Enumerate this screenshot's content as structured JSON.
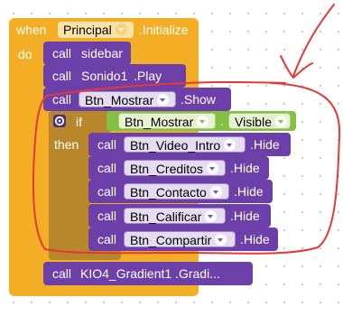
{
  "event_block": {
    "when_label": "when",
    "component": "Principal",
    "event": ".Initialize",
    "do_label": "do"
  },
  "statements": [
    {
      "call": "call",
      "name": "sidebar"
    },
    {
      "call": "call",
      "name": "Sonido1",
      "method": ".Play"
    },
    {
      "call": "call",
      "component": "Btn_Mostrar",
      "method": ".Show"
    }
  ],
  "if_block": {
    "if_label": "if",
    "then_label": "then",
    "getter_component": "Btn_Mostrar",
    "getter_dot": ".",
    "getter_property": "Visible"
  },
  "then_calls": [
    {
      "call": "call",
      "component": "Btn_Video_Intro",
      "method": ".Hide"
    },
    {
      "call": "call",
      "component": "Btn_Creditos",
      "method": ".Hide"
    },
    {
      "call": "call",
      "component": "Btn_Contacto",
      "method": ".Hide"
    },
    {
      "call": "call",
      "component": "Btn_Calificar",
      "method": ".Hide"
    },
    {
      "call": "call",
      "component": "Btn_Compartir",
      "method": ".Hide"
    }
  ],
  "last_call": {
    "call": "call",
    "text": "KIO4_Gradient1 .Gradi..."
  },
  "colors": {
    "event": "#f4ae25",
    "procedure": "#6d3fa8",
    "control": "#b8872b",
    "logic_getter": "#82c141",
    "annotation": "#e53935"
  }
}
